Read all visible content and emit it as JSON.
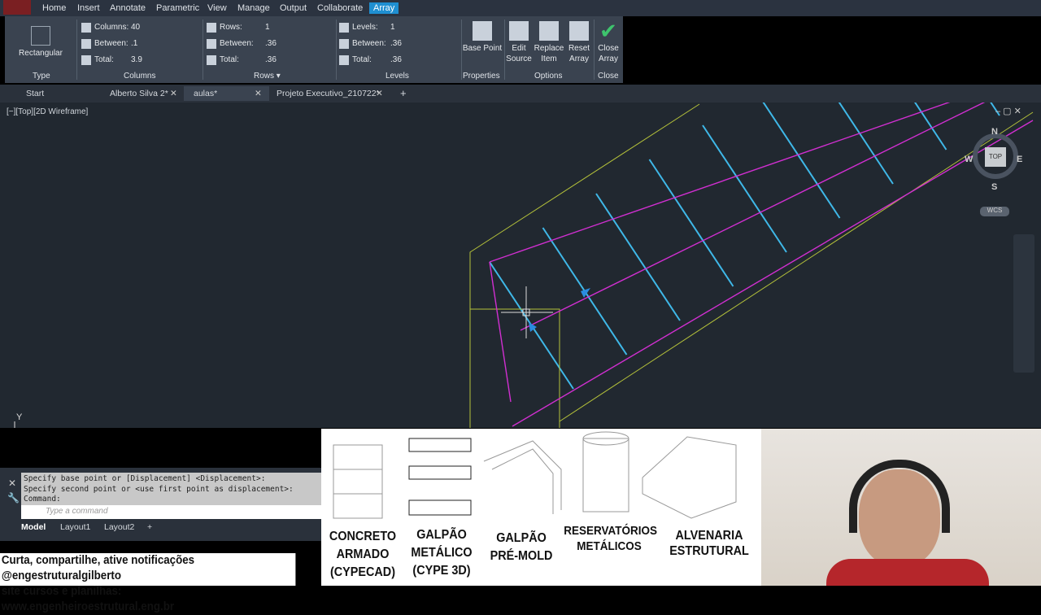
{
  "menubar": {
    "tabs": [
      "Home",
      "Insert",
      "Annotate",
      "Parametric",
      "View",
      "Manage",
      "Output",
      "Collaborate",
      "Array"
    ],
    "active": "Array"
  },
  "ribbon": {
    "type": {
      "button": "Rectangular",
      "group": "Type"
    },
    "columns": {
      "columns_label": "Columns:",
      "columns": "40",
      "between_label": "Between:",
      "between": ".1",
      "total_label": "Total:",
      "total": "3.9",
      "group": "Columns"
    },
    "rows": {
      "rows_label": "Rows:",
      "rows": "1",
      "between_label": "Between:",
      "between": ".36",
      "total_label": "Total:",
      "total": ".36",
      "group": "Rows ▾"
    },
    "levels": {
      "levels_label": "Levels:",
      "levels": "1",
      "between_label": "Between:",
      "between": ".36",
      "total_label": "Total:",
      "total": ".36",
      "group": "Levels"
    },
    "properties": {
      "base_point": "Base Point",
      "group": "Properties"
    },
    "options": {
      "edit_source": "Edit Source",
      "replace_item": "Replace Item",
      "reset_array": "Reset Array",
      "group": "Options"
    },
    "close": {
      "close_array": "Close Array",
      "group": "Close"
    }
  },
  "file_tabs": [
    "Start",
    "Alberto Silva 2*",
    "aulas*",
    "Projeto Executivo_210722*"
  ],
  "viewport": {
    "label": "[−][Top][2D Wireframe]",
    "viewcube": {
      "top": "TOP",
      "n": "N",
      "s": "S",
      "e": "E",
      "w": "W",
      "wcs": "WCS"
    },
    "ucs_y": "Y"
  },
  "command": {
    "lines": [
      "Specify base point or [Displacement] <Displacement>:",
      "Specify second point or <use first point as displacement>:",
      "Command:"
    ],
    "placeholder": "Type a command"
  },
  "layout_tabs": [
    "Model",
    "Layout1",
    "Layout2"
  ],
  "footer": {
    "line1": "Curta, compartilhe, ative notificações @engestruturalgilberto",
    "line2": "site cursos e planilhas: www.engenheiroestrutural.eng.br"
  },
  "promo": [
    "CONCRETO ARMADO (CYPECAD)",
    "GALPÃO METÁLICO (CYPE 3D)",
    "GALPÃO PRÉ-MOLD",
    "RESERVATÓRIOS METÁLICOS",
    "ALVENARIA ESTRUTURAL"
  ]
}
